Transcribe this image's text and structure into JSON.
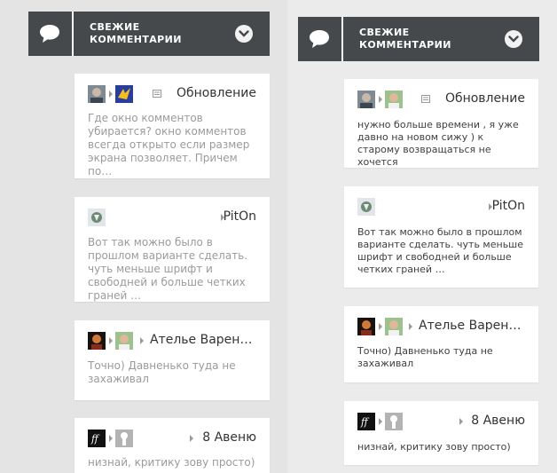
{
  "header": {
    "title": "СВЕЖИЕ КОММЕНТАРИИ",
    "icon": "speech-bubble-icon",
    "toggle_icon": "chevron-down-icon",
    "color": "#45494b"
  },
  "left_panel": {
    "cards": [
      {
        "post_title": "Обновление",
        "comment": "Где окно комментов убирается? окно комментов всегда открыто если размер экрана позволяет. Причем по…"
      },
      {
        "post_title": "PitOn",
        "comment": "Вот так можно было в прошлом варианте сделать. чуть меньше шрифт и свободней и больше четких граней …"
      },
      {
        "post_title": "Ателье Варень…",
        "comment": "Точно) Давненько туда не захаживал"
      },
      {
        "post_title": "8 Авеню",
        "comment": "низнай, критику зову просто)"
      }
    ]
  },
  "right_panel": {
    "cards": [
      {
        "post_title": "Обновление",
        "comment": "нужно больше времени , я уже давно на новом сижу ) к старому возвращаться не хочется"
      },
      {
        "post_title": "PitOn",
        "comment": "Вот так можно было в прошлом варианте сделать. чуть меньше шрифт и свободней и больше четких граней …"
      },
      {
        "post_title": "Ателье Варень…",
        "comment": "Точно) Давненько туда не захаживал"
      },
      {
        "post_title": "8 Авеню",
        "comment": "низнай, критику зову просто)"
      }
    ]
  }
}
